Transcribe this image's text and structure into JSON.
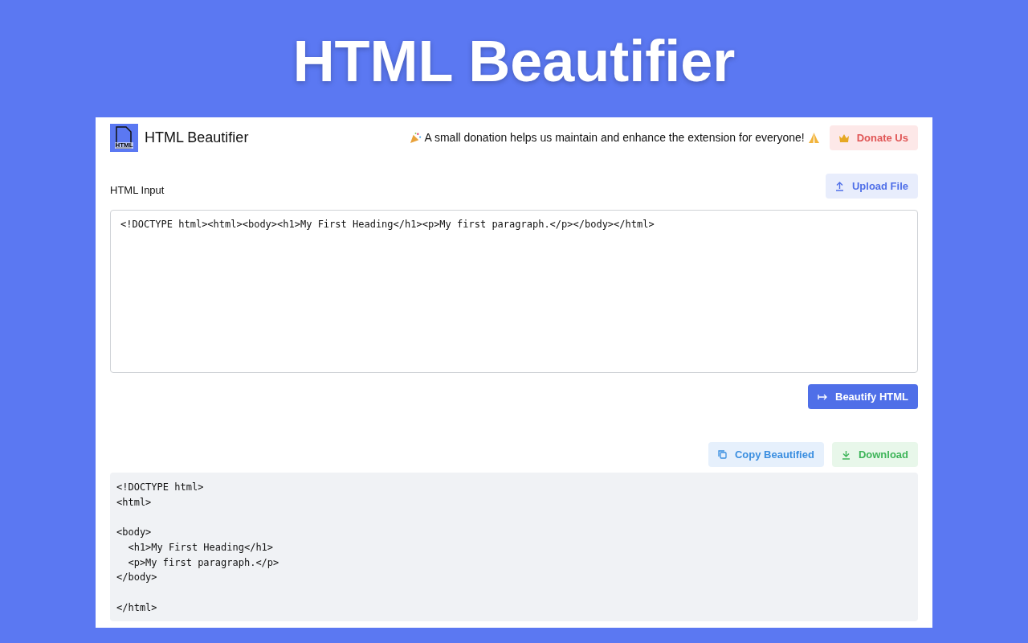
{
  "page_title": "HTML Beautifier",
  "header": {
    "logo_text": "HTML",
    "app_name": "HTML Beautifier",
    "message": "A small donation helps us maintain and enhance the extension for everyone!",
    "donate_button": "Donate Us"
  },
  "input": {
    "label": "HTML Input",
    "upload_button": "Upload File",
    "value": "<!DOCTYPE html><html><body><h1>My First Heading</h1><p>My first paragraph.</p></body></html>"
  },
  "beautify_button": "Beautify HTML",
  "output": {
    "copy_button": "Copy Beautified",
    "download_button": "Download",
    "code": "<!DOCTYPE html>\n<html>\n\n<body>\n  <h1>My First Heading</h1>\n  <p>My first paragraph.</p>\n</body>\n\n</html>"
  }
}
